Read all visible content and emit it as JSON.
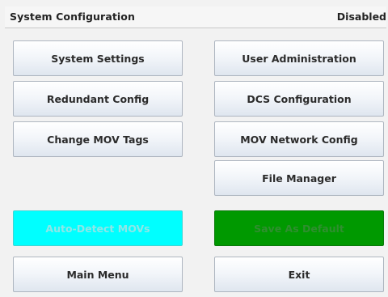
{
  "header": {
    "title": "System Configuration",
    "status": "Disabled"
  },
  "buttons": {
    "system_settings": "System Settings",
    "user_administration": "User Administration",
    "redundant_config": "Redundant Config",
    "dcs_configuration": "DCS Configuration",
    "change_mov_tags": "Change MOV Tags",
    "mov_network_config": "MOV Network Config",
    "file_manager": "File Manager",
    "auto_detect_movs": "Auto-Detect MOVs",
    "save_as_default": "Save As Default",
    "main_menu": "Main Menu",
    "exit": "Exit"
  },
  "colors": {
    "auto_detect_bg": "#00ffff",
    "save_default_bg": "#009900"
  }
}
